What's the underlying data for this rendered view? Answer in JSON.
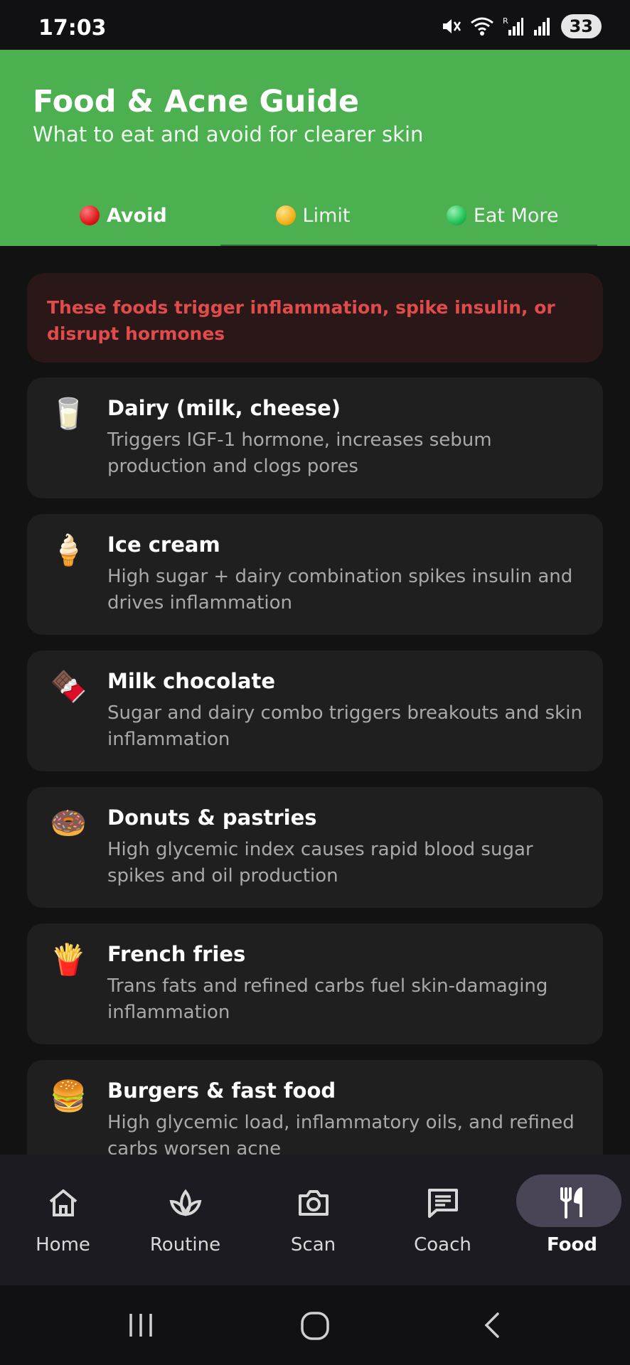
{
  "status_bar": {
    "time": "17:03",
    "battery": "33"
  },
  "header": {
    "title": "Food & Acne Guide",
    "subtitle": "What to eat and avoid for clearer skin"
  },
  "tabs": [
    {
      "label": "Avoid",
      "color": "#e01a1a"
    },
    {
      "label": "Limit",
      "color": "#f5b21b"
    },
    {
      "label": "Eat More",
      "color": "#22c35a"
    }
  ],
  "warning": "These foods trigger inflammation, spike insulin, or disrupt hormones",
  "foods": [
    {
      "emoji": "🥛",
      "title": "Dairy (milk, cheese)",
      "desc": "Triggers IGF-1 hormone, increases sebum production and clogs pores"
    },
    {
      "emoji": "🍦",
      "title": "Ice cream",
      "desc": "High sugar + dairy combination spikes insulin and drives inflammation"
    },
    {
      "emoji": "🍫",
      "title": "Milk chocolate",
      "desc": "Sugar and dairy combo triggers breakouts and skin inflammation"
    },
    {
      "emoji": "🍩",
      "title": "Donuts & pastries",
      "desc": "High glycemic index causes rapid blood sugar spikes and oil production"
    },
    {
      "emoji": "🍟",
      "title": "French fries",
      "desc": "Trans fats and refined carbs fuel skin-damaging inflammation"
    },
    {
      "emoji": "🍔",
      "title": "Burgers & fast food",
      "desc": "High glycemic load, inflammatory oils, and refined carbs worsen acne"
    }
  ],
  "nav": [
    {
      "label": "Home",
      "icon": "home-icon"
    },
    {
      "label": "Routine",
      "icon": "leaf-icon"
    },
    {
      "label": "Scan",
      "icon": "camera-icon"
    },
    {
      "label": "Coach",
      "icon": "chat-icon"
    },
    {
      "label": "Food",
      "icon": "fork-knife-icon"
    }
  ],
  "colors": {
    "header": "#4caf50",
    "background": "#121212",
    "card": "#1f1f1f",
    "warning_text": "#e04b4b"
  }
}
